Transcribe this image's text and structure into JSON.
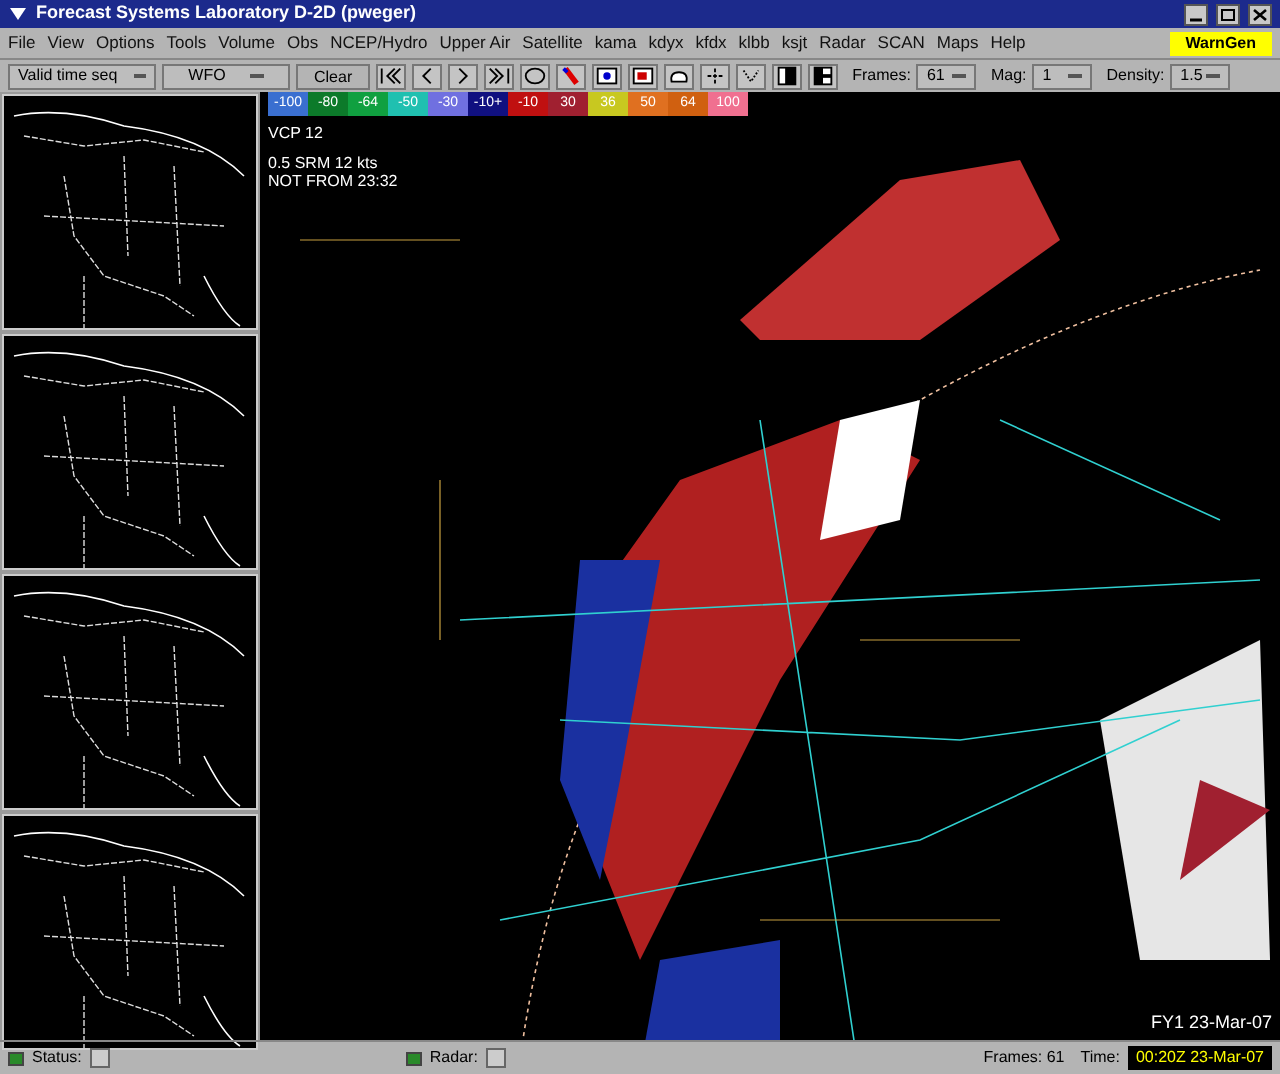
{
  "window": {
    "title": "Forecast Systems Laboratory D-2D (pweger)"
  },
  "menu": [
    "File",
    "View",
    "Options",
    "Tools",
    "Volume",
    "Obs",
    "NCEP/Hydro",
    "Upper Air",
    "Satellite",
    "kama",
    "kdyx",
    "kfdx",
    "klbb",
    "ksjt",
    "Radar",
    "SCAN",
    "Maps",
    "Help"
  ],
  "warngen": "WarnGen",
  "toolbar": {
    "time_mode": "Valid time seq",
    "scale": "WFO",
    "clear": "Clear",
    "frames_label": "Frames:",
    "frames": "61",
    "mag_label": "Mag:",
    "mag": "1",
    "density_label": "Density:",
    "density": "1.5"
  },
  "color_bar": [
    {
      "label": "-100",
      "color": "#3a6fd0"
    },
    {
      "label": "-80",
      "color": "#0c7a2a"
    },
    {
      "label": "-64",
      "color": "#10a040"
    },
    {
      "label": "-50",
      "color": "#20c0b0"
    },
    {
      "label": "-30",
      "color": "#7070e0"
    },
    {
      "label": "-10+",
      "color": "#101080"
    },
    {
      "label": "-10",
      "color": "#c01010"
    },
    {
      "label": "30",
      "color": "#a02030"
    },
    {
      "label": "36",
      "color": "#c8c820"
    },
    {
      "label": "50",
      "color": "#e07020"
    },
    {
      "label": "64",
      "color": "#d06010"
    },
    {
      "label": "100",
      "color": "#f07090"
    }
  ],
  "overlay": [
    "VCP 12",
    "0.5 SRM 12 kts",
    "NOT FROM 23:32"
  ],
  "bottom_label": "FY1 23-Mar-07",
  "status_bar": {
    "status": "Status:",
    "radar": "Radar:",
    "frames": "Frames: 61",
    "time_label": "Time:",
    "time": "00:20Z 23-Mar-07"
  }
}
